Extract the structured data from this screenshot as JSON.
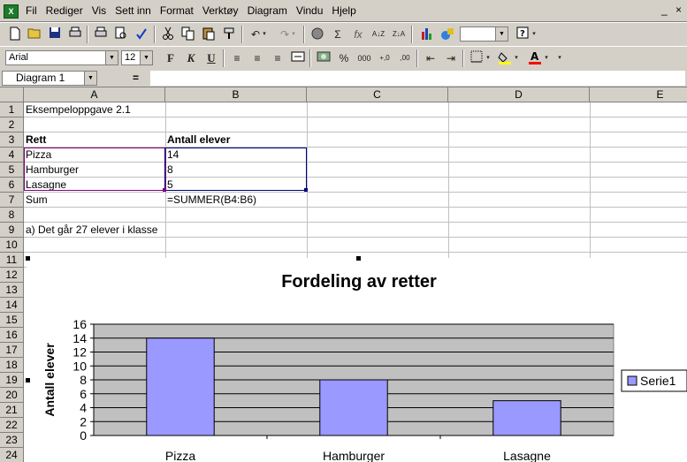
{
  "menubar": {
    "items": [
      "Fil",
      "Rediger",
      "Vis",
      "Sett inn",
      "Format",
      "Verktøy",
      "Diagram",
      "Vindu",
      "Hjelp"
    ],
    "app_icon_label": "X",
    "minimize_label": "_",
    "close_label": "×"
  },
  "toolbar_formatting": {
    "font": "Arial",
    "size": "12",
    "bold_label": "F",
    "italic_label": "K",
    "underline_label": "U"
  },
  "formula_bar": {
    "name_box": "Diagram 1",
    "equals": "=",
    "content": ""
  },
  "columns": [
    "A",
    "B",
    "C",
    "D",
    "E"
  ],
  "rows": [
    "1",
    "2",
    "3",
    "4",
    "5",
    "6",
    "7",
    "8",
    "9",
    "10",
    "11",
    "12",
    "13",
    "14",
    "15",
    "16",
    "17",
    "18",
    "19",
    "20",
    "21",
    "22",
    "23",
    "24"
  ],
  "cells": {
    "A1": "Eksempeloppgave 2.1",
    "A3": "Rett",
    "B3": "Antall elever",
    "A4": "Pizza",
    "B4": "14",
    "A5": "Hamburger",
    "B5": "8",
    "A6": "Lasagne",
    "B6": "5",
    "A7": "Sum",
    "B7": "=SUMMER(B4:B6)",
    "A9": "a) Det går 27 elever i klasse"
  },
  "chart_data": {
    "type": "bar",
    "title": "Fordeling av retter",
    "categories": [
      "Pizza",
      "Hamburger",
      "Lasagne"
    ],
    "series": [
      {
        "name": "Serie1",
        "values": [
          14,
          8,
          5
        ]
      }
    ],
    "ylabel": "Antall elever",
    "xlabel": "",
    "ylim": [
      0,
      16
    ],
    "yticks": [
      0,
      2,
      4,
      6,
      8,
      10,
      12,
      14,
      16
    ],
    "grid": true,
    "legend": "right",
    "colors": {
      "bar": "#9999ff",
      "plot_bg": "#c0c0c0",
      "bar_border": "#000000"
    }
  }
}
